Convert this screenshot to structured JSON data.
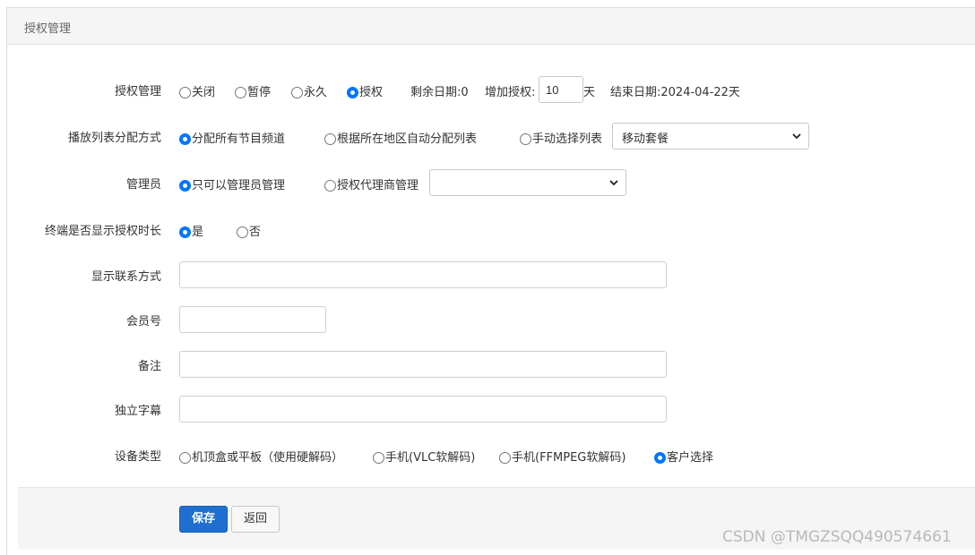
{
  "panel": {
    "title": "授权管理"
  },
  "form": {
    "auth": {
      "label": "授权管理",
      "options": [
        {
          "label": "关闭",
          "checked": false
        },
        {
          "label": "暂停",
          "checked": false
        },
        {
          "label": "永久",
          "checked": false
        },
        {
          "label": "授权",
          "checked": true
        }
      ],
      "remaining": "剩余日期:0",
      "add_label": "增加授权:",
      "add_value": "10",
      "unit": "天",
      "end_date": "结束日期:2024-04-22天"
    },
    "playlist": {
      "label": "播放列表分配方式",
      "options": [
        {
          "label": "分配所有节目频道",
          "checked": true
        },
        {
          "label": "根据所在地区自动分配列表",
          "checked": false
        },
        {
          "label": "手动选择列表",
          "checked": false
        }
      ],
      "select_value": "移动套餐"
    },
    "admin": {
      "label": "管理员",
      "options": [
        {
          "label": "只可以管理员管理",
          "checked": true
        },
        {
          "label": "授权代理商管理",
          "checked": false
        }
      ],
      "select_value": ""
    },
    "show_duration": {
      "label": "终端是否显示授权时长",
      "options": [
        {
          "label": "是",
          "checked": true
        },
        {
          "label": "否",
          "checked": false
        }
      ]
    },
    "contact": {
      "label": "显示联系方式",
      "value": ""
    },
    "member": {
      "label": "会员号",
      "value": ""
    },
    "remark": {
      "label": "备注",
      "value": ""
    },
    "subtitle": {
      "label": "独立字幕",
      "value": ""
    },
    "device": {
      "label": "设备类型",
      "options": [
        {
          "label": "机顶盒或平板（使用硬解码）",
          "checked": false
        },
        {
          "label": "手机(VLC软解码)",
          "checked": false
        },
        {
          "label": "手机(FFMPEG软解码)",
          "checked": false
        },
        {
          "label": "客户选择",
          "checked": true
        }
      ]
    }
  },
  "buttons": {
    "save": "保存",
    "back": "返回"
  },
  "watermark": "CSDN @TMGZSQQ490574661",
  "colors": {
    "primary": "#1e6fd0",
    "radio_checked": "#0075ff"
  }
}
